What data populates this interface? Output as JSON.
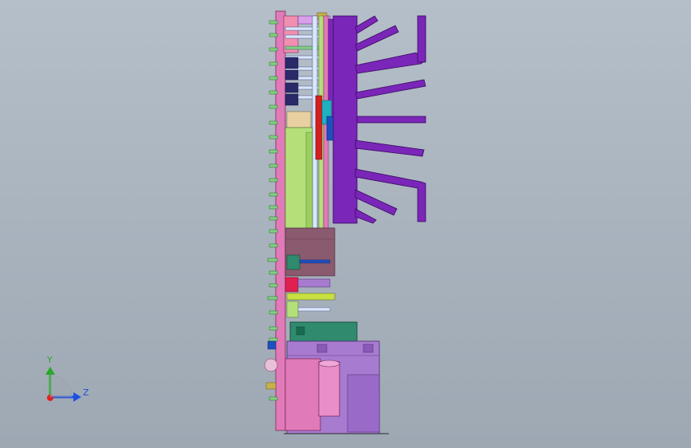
{
  "viewport": {
    "background_top": "#b5bfc9",
    "background_bottom": "#9ea8b3"
  },
  "model": {
    "name_icon": "pcb-assembly-side-view",
    "colors": {
      "pcb": "#e07ab8",
      "heatsink": "#7a26b8",
      "connector_block": "#f08fb0",
      "green_module": "#b4e07a",
      "dark_module": "#8a5a6e",
      "teal_component": "#2f8a6e",
      "lavender_housing": "#a77bd0",
      "pin_green": "#7fd07f",
      "pin_light": "#d8e8ff",
      "navy_part": "#2a2a6a",
      "red_part": "#d02020",
      "cyan_part": "#20b0c0"
    }
  },
  "triad": {
    "y_label": "Y",
    "z_label": "Z",
    "y_color": "#2aa82a",
    "z_color": "#2050e0",
    "x_color": "#e02020"
  }
}
